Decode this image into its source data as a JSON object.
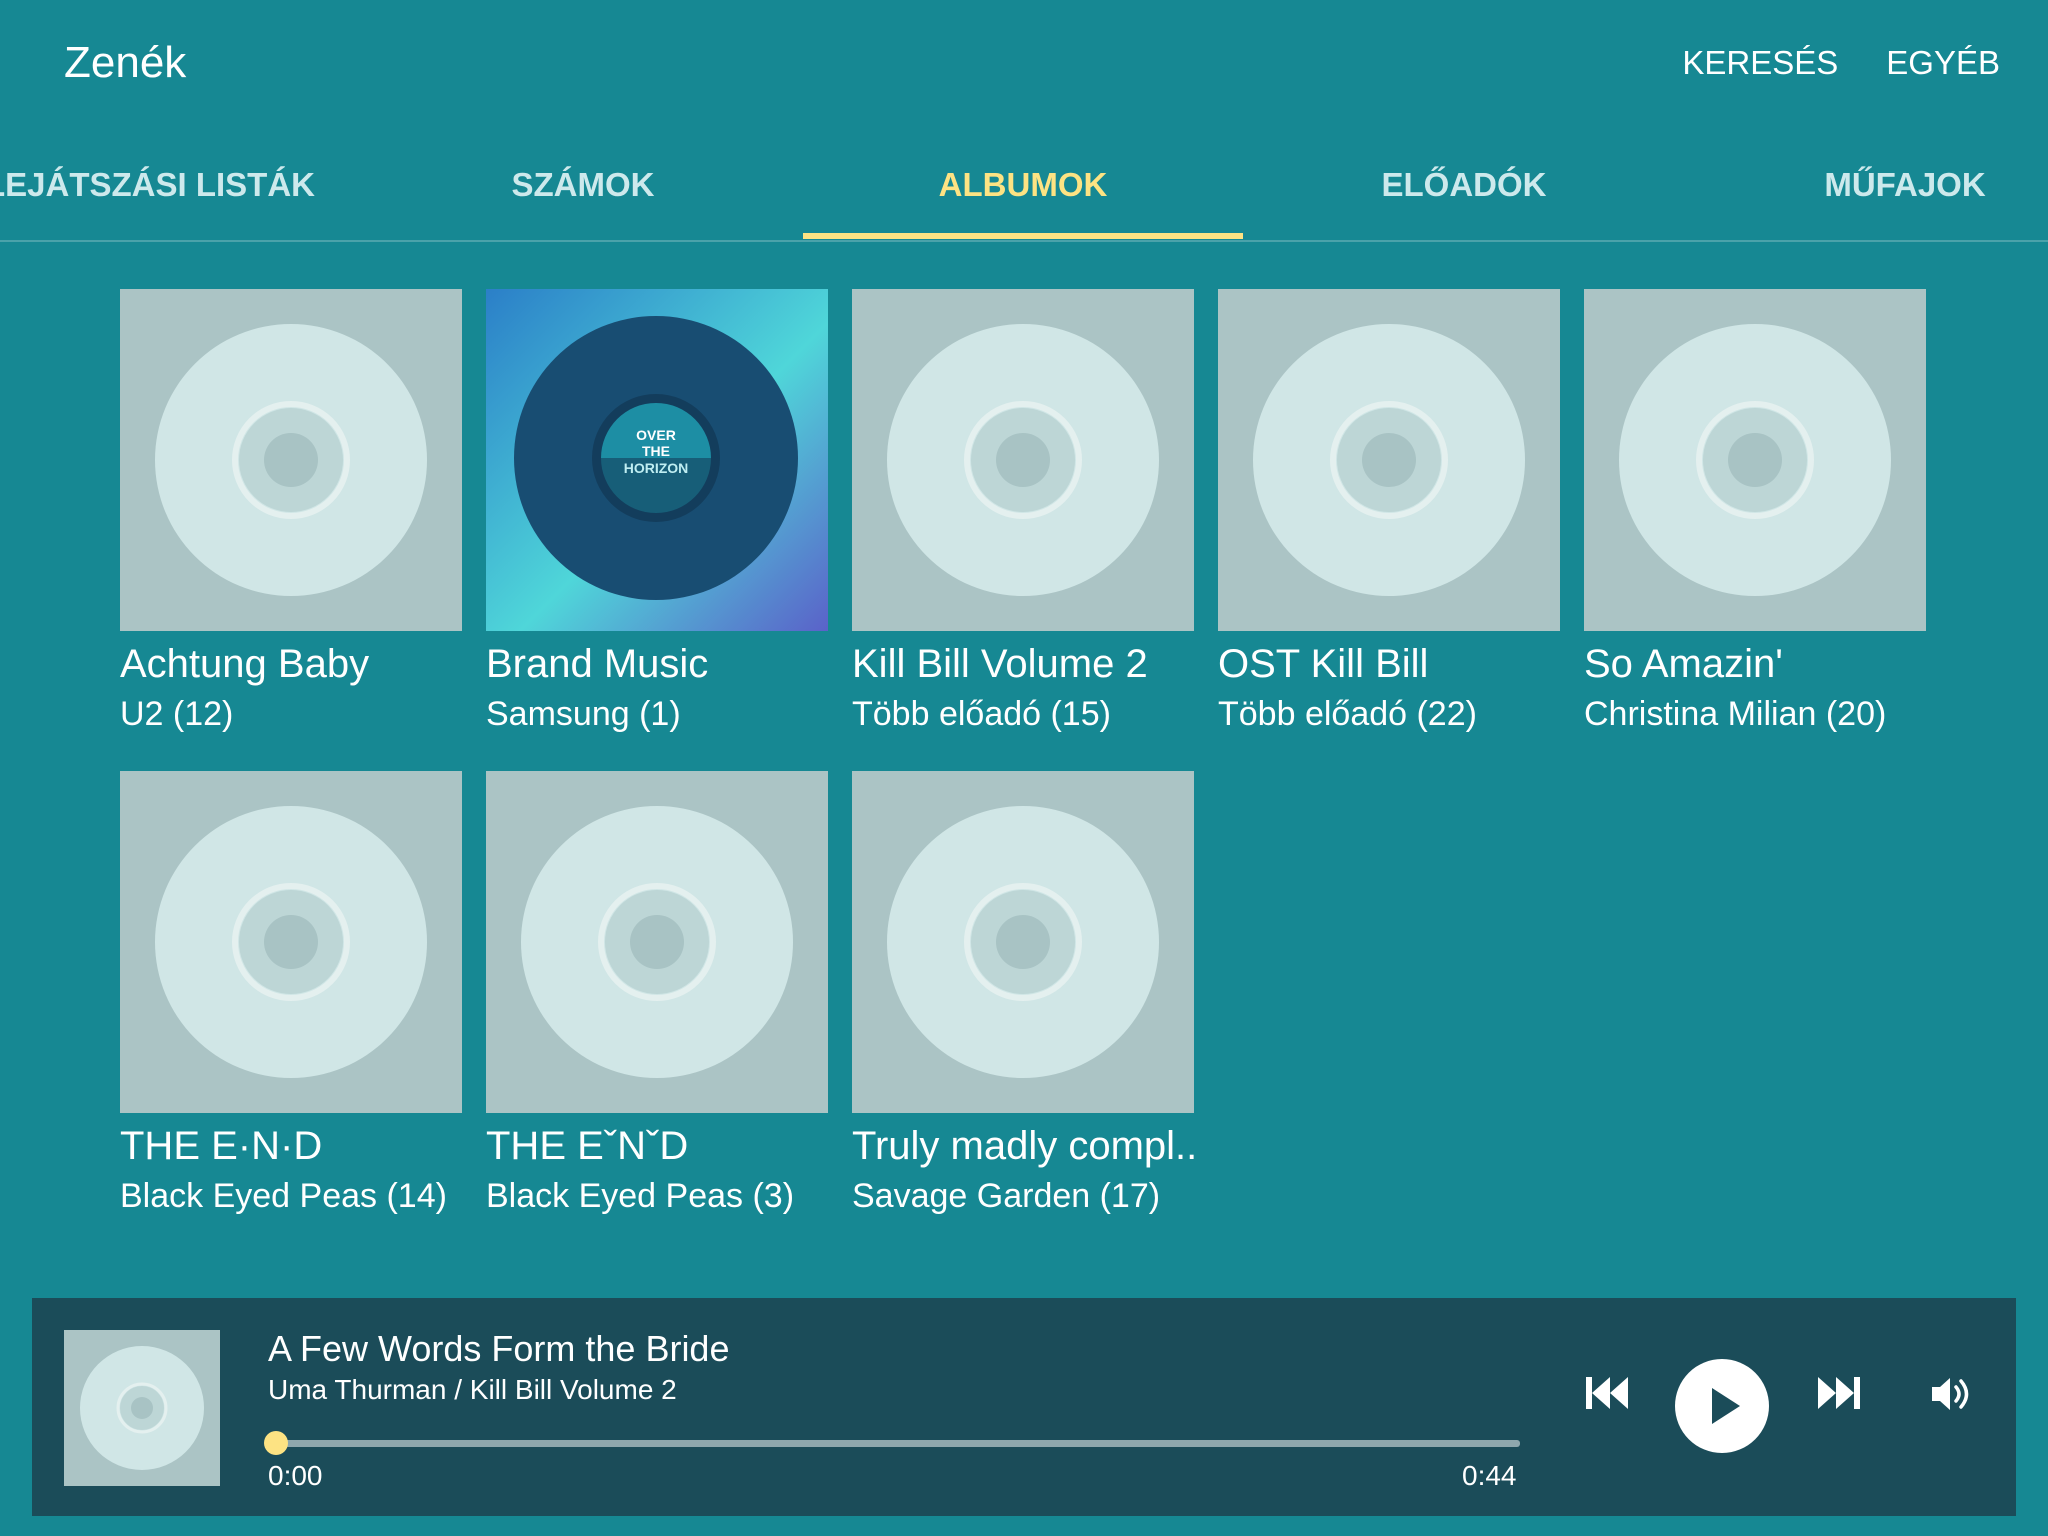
{
  "app": {
    "title": "Zenék",
    "actions": [
      "KERESÉS",
      "EGYÉB"
    ]
  },
  "tabs": [
    {
      "label": "LEJÁTSZÁSI LISTÁK",
      "active": false
    },
    {
      "label": "SZÁMOK",
      "active": false
    },
    {
      "label": "ALBUMOK",
      "active": true
    },
    {
      "label": "ELŐADÓK",
      "active": false
    },
    {
      "label": "MŰFAJOK",
      "active": false
    }
  ],
  "albums": [
    {
      "name": "Achtung Baby",
      "subtitle": "U2 (12)",
      "cover": "disc-placeholder"
    },
    {
      "name": "Brand Music",
      "subtitle": "Samsung (1)",
      "cover": "vinyl-art",
      "cover_text": [
        "OVER",
        "THE",
        "HORIZON"
      ]
    },
    {
      "name": "Kill Bill Volume 2",
      "subtitle": "Több előadó (15)",
      "cover": "disc-placeholder"
    },
    {
      "name": "OST Kill Bill",
      "subtitle": "Több előadó (22)",
      "cover": "disc-placeholder"
    },
    {
      "name": "So Amazin'",
      "subtitle": "Christina Milian (20)",
      "cover": "disc-placeholder"
    },
    {
      "name": "THE E·N·D",
      "subtitle": "Black Eyed Peas (14)",
      "cover": "disc-placeholder"
    },
    {
      "name": "THE EˇNˇD",
      "subtitle": "Black Eyed Peas (3)",
      "cover": "disc-placeholder"
    },
    {
      "name": "Truly madly compl..",
      "subtitle": "Savage Garden (17)",
      "cover": "disc-placeholder"
    }
  ],
  "player": {
    "title": "A Few Words Form the Bride",
    "subtitle": "Uma Thurman / Kill Bill Volume 2",
    "elapsed": "0:00",
    "duration": "0:44",
    "progress": 0,
    "icons": [
      "previous-icon",
      "play-icon",
      "next-icon",
      "volume-icon"
    ]
  },
  "colors": {
    "background": "#168893",
    "accent": "#fde383",
    "player_background": "#1b4c59",
    "cover_placeholder": "#abc4c5"
  }
}
